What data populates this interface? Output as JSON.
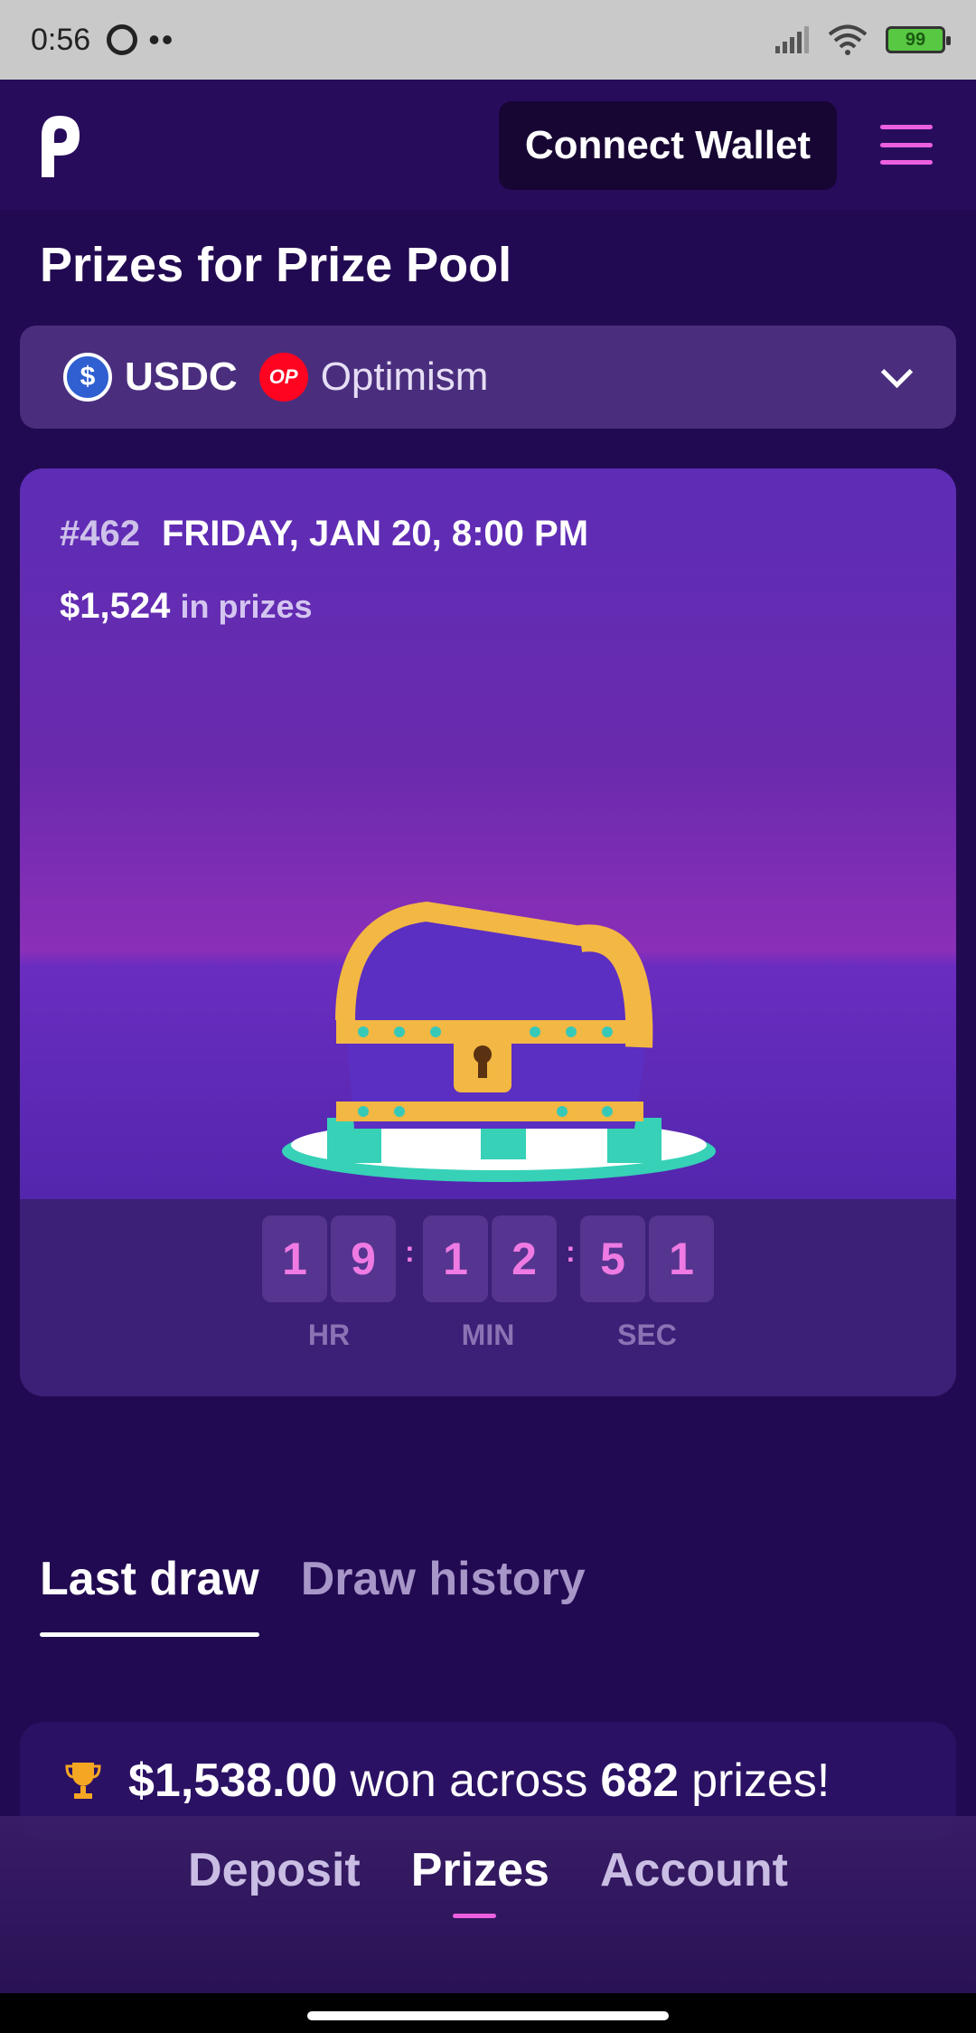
{
  "status_bar": {
    "time": "0:56",
    "dots": "••",
    "battery": "99"
  },
  "header": {
    "connect_label": "Connect Wallet"
  },
  "page_title": "Prizes for Prize Pool",
  "pool_selector": {
    "token": "USDC",
    "network_badge": "OP",
    "network": "Optimism"
  },
  "draw_card": {
    "draw_number": "#462",
    "date": "FRIDAY, JAN 20, 8:00 PM",
    "prize_amount": "$1,524",
    "prize_suffix": "in prizes",
    "countdown": {
      "hr": [
        "1",
        "9"
      ],
      "min": [
        "1",
        "2"
      ],
      "sec": [
        "5",
        "1"
      ],
      "labels": {
        "hr": "HR",
        "min": "MIN",
        "sec": "SEC"
      }
    }
  },
  "tabs": {
    "last_draw": "Last draw",
    "draw_history": "Draw history",
    "active": "Last draw"
  },
  "summary": {
    "amount": "$1,538.00",
    "middle": "won across",
    "count": "682",
    "suffix": "prizes!"
  },
  "bottom_nav": {
    "items": [
      "Deposit",
      "Prizes",
      "Account"
    ],
    "active": "Prizes"
  },
  "colors": {
    "background": "#220a52",
    "accent": "#ec5fe0",
    "card": "#3e1f7a"
  }
}
